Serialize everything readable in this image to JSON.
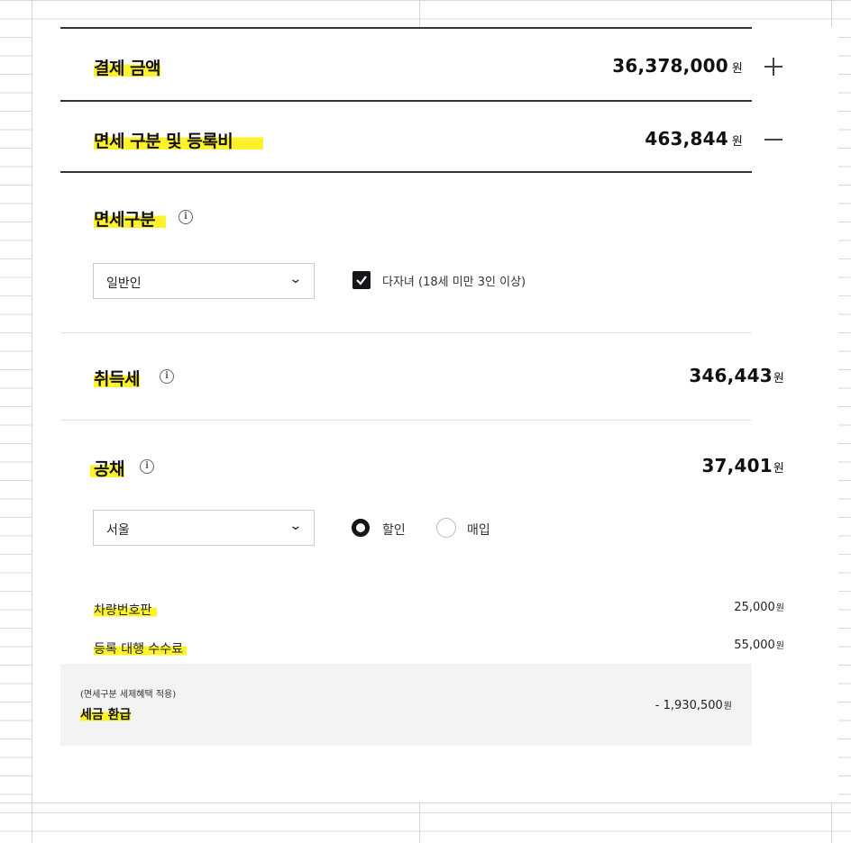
{
  "payment": {
    "title": "결제 금액",
    "amount": "36,378,000",
    "unit": "원"
  },
  "tax_section": {
    "title": "면세 구분 및 등록비",
    "amount": "463,844",
    "unit": "원"
  },
  "exemption": {
    "label": "면세구분",
    "select_value": "일반인",
    "checkbox_label": "다자녀 (18세 미만 3인 이상)",
    "checkbox_checked": true
  },
  "acquisition_tax": {
    "label": "취득세",
    "amount": "346,443",
    "unit": "원"
  },
  "bond": {
    "label": "공채",
    "amount": "37,401",
    "unit": "원",
    "region": "서울",
    "options": [
      "할인",
      "매입"
    ],
    "selected_option": "할인"
  },
  "fees": [
    {
      "label": "차량번호판",
      "amount": "25,000",
      "unit": "원"
    },
    {
      "label": "등록 대행 수수료",
      "amount": "55,000",
      "unit": "원"
    }
  ],
  "refund": {
    "note": "(면세구분 세제혜택 적용)",
    "title": "세금 환급",
    "amount": "- 1,930,500",
    "unit": "원"
  },
  "colors": {
    "highlight": "#fff22a",
    "dark": "#14161a",
    "box_bg": "#f3f3f3"
  },
  "icons": {
    "expand": "plus-icon",
    "collapse": "minus-icon",
    "info": "info-icon",
    "dropdown": "chevron-down-icon"
  }
}
